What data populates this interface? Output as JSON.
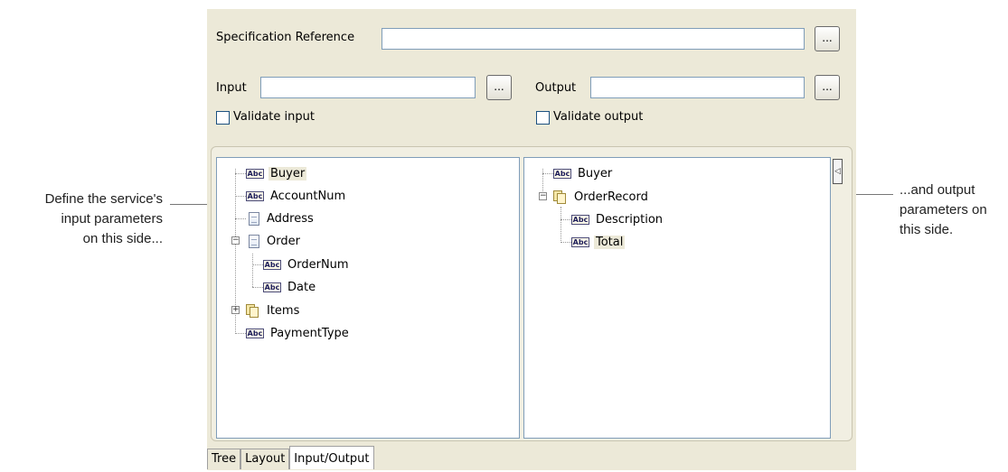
{
  "annotations": {
    "left": [
      "Define the service's",
      "input parameters",
      "on this side..."
    ],
    "right": [
      "...and output",
      "parameters on",
      "this side."
    ]
  },
  "form": {
    "spec_label": "Specification Reference",
    "spec_value": "",
    "input_label": "Input",
    "input_value": "",
    "output_label": "Output",
    "output_value": "",
    "browse_label": "...",
    "validate_input_label": "Validate input",
    "validate_input_checked": false,
    "validate_output_label": "Validate output",
    "validate_output_checked": false
  },
  "input_tree": [
    {
      "label": "Buyer",
      "icon": "abc-field-icon",
      "selected": true
    },
    {
      "label": "AccountNum",
      "icon": "abc-field-icon"
    },
    {
      "label": "Address",
      "icon": "document-icon"
    },
    {
      "label": "Order",
      "icon": "document-icon",
      "expanded": true
    },
    {
      "label": "OrderNum",
      "icon": "abc-field-icon"
    },
    {
      "label": "Date",
      "icon": "abc-field-icon"
    },
    {
      "label": "Items",
      "icon": "document-list-icon",
      "expanded": false
    },
    {
      "label": "PaymentType",
      "icon": "abc-field-icon"
    }
  ],
  "output_tree": [
    {
      "label": "Buyer",
      "icon": "abc-field-icon"
    },
    {
      "label": "OrderRecord",
      "icon": "document-list-icon",
      "expanded": true
    },
    {
      "label": "Description",
      "icon": "abc-field-icon"
    },
    {
      "label": "Total",
      "icon": "abc-field-icon",
      "selected": true
    }
  ],
  "icon_text": "Abc",
  "tabs": [
    {
      "label": "Tree",
      "active": false
    },
    {
      "label": "Layout",
      "active": false
    },
    {
      "label": "Input/Output",
      "active": true
    }
  ],
  "colors": {
    "panel": "#ece9d8",
    "field_border": "#7f9db9"
  }
}
